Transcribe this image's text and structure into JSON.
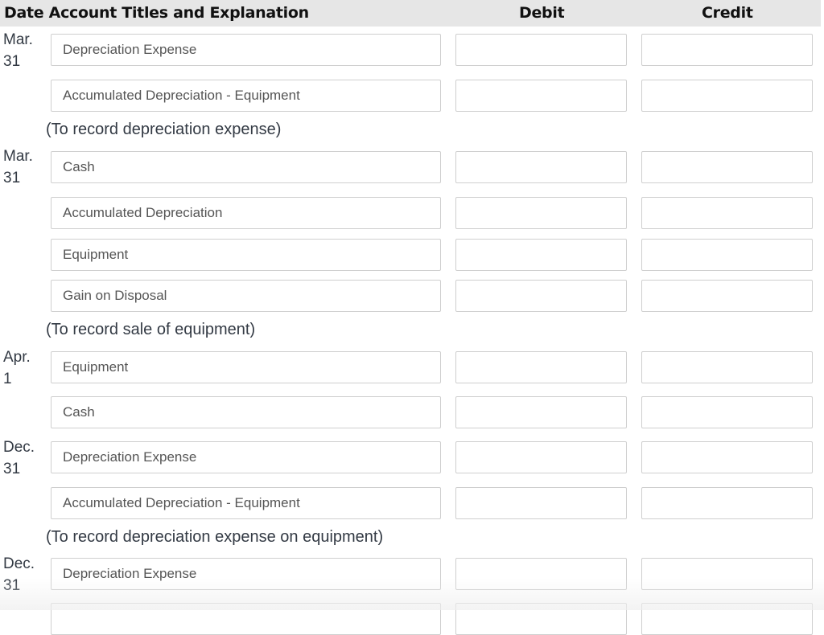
{
  "header": {
    "date_account": "Date Account Titles and Explanation",
    "debit": "Debit",
    "credit": "Credit"
  },
  "entries": [
    {
      "date_month": "Mar.",
      "date_day": "31",
      "lines": [
        "Depreciation Expense",
        "Accumulated Depreciation - Equipment"
      ],
      "explanation": "(To record depreciation expense)"
    },
    {
      "date_month": "Mar.",
      "date_day": "31",
      "lines": [
        "Cash",
        "Accumulated Depreciation",
        "Equipment",
        "Gain on Disposal"
      ],
      "explanation": "(To record sale of equipment)"
    },
    {
      "date_month": "Apr.",
      "date_day": "1",
      "lines": [
        "Equipment",
        "Cash"
      ],
      "explanation": ""
    },
    {
      "date_month": "Dec.",
      "date_day": "31",
      "lines": [
        "Depreciation Expense",
        "Accumulated Depreciation - Equipment"
      ],
      "explanation": "(To record depreciation expense on equipment)"
    },
    {
      "date_month": "Dec.",
      "date_day": "31",
      "lines": [
        "Depreciation Expense",
        ""
      ],
      "explanation": ""
    }
  ],
  "debit_values": [
    "",
    "",
    "",
    "",
    "",
    "",
    "",
    "",
    "",
    "",
    "",
    ""
  ],
  "credit_values": [
    "",
    "",
    "",
    "",
    "",
    "",
    "",
    "",
    "",
    "",
    "",
    ""
  ]
}
